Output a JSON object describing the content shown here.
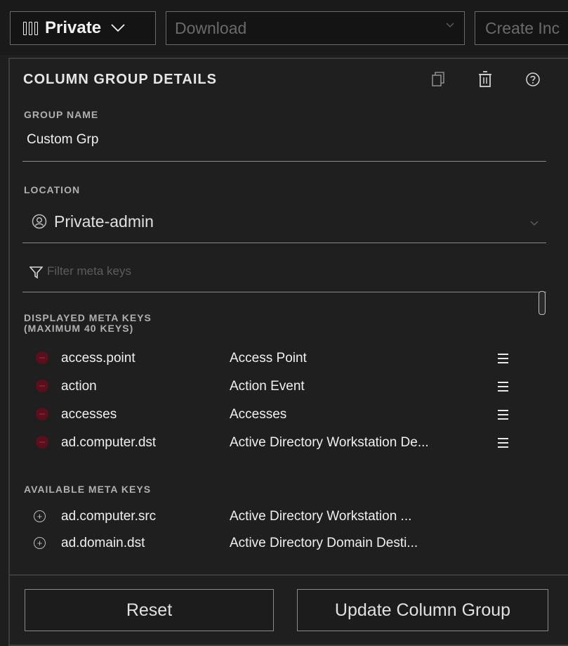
{
  "topbar": {
    "column_group_button": "Private",
    "download_placeholder": "Download",
    "create_button": "Create Inc"
  },
  "panel": {
    "heading": "COLUMN GROUP DETAILS",
    "group_name_label": "GROUP NAME",
    "group_name_value": "Custom Grp",
    "location_label": "LOCATION",
    "location_value": "Private-admin",
    "filter_placeholder": "Filter meta keys",
    "displayed_label_line1": "DISPLAYED META KEYS",
    "displayed_label_line2": "(MAXIMUM 40 KEYS)",
    "displayed_keys": [
      {
        "key": "access.point",
        "description": "Access Point"
      },
      {
        "key": "action",
        "description": "Action Event"
      },
      {
        "key": "accesses",
        "description": "Accesses"
      },
      {
        "key": "ad.computer.dst",
        "description": "Active Directory Workstation De..."
      }
    ],
    "available_label": "AVAILABLE META KEYS",
    "available_keys": [
      {
        "key": "ad.computer.src",
        "description": "Active Directory Workstation ..."
      },
      {
        "key": "ad.domain.dst",
        "description": "Active Directory Domain Desti..."
      }
    ],
    "reset_label": "Reset",
    "update_label": "Update Column Group"
  },
  "icons": {
    "columns": "columns-icon",
    "copy": "copy-icon",
    "delete": "trash-icon",
    "help": "help-icon",
    "user": "user-icon",
    "filter": "filter-icon",
    "remove": "remove-circle-icon",
    "drag": "drag-handle-icon",
    "add": "add-circle-icon"
  },
  "colors": {
    "background": "#1e1e1e",
    "remove_dot": "#5a0f1c",
    "text": "#f0f0f0",
    "muted": "#6a6a6a"
  }
}
